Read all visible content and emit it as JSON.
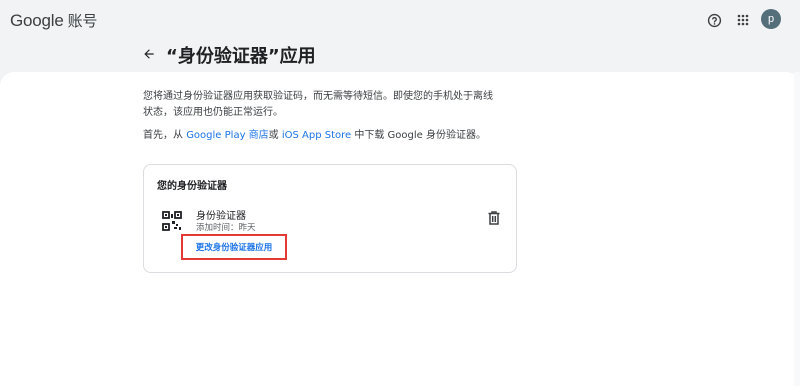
{
  "header": {
    "logo_google": "Google",
    "logo_account": "账号",
    "help_icon": "help-circle-icon",
    "apps_icon": "apps-grid-icon",
    "avatar_initial": "p"
  },
  "page": {
    "title": "“身份验证器”应用",
    "back_icon": "arrow-back-icon"
  },
  "content": {
    "description": "您将通过身份验证器应用获取验证码，而无需等待短信。即使您的手机处于离线状态，该应用也仍能正常运行。",
    "download_prefix": "首先，从 ",
    "google_play_link": "Google Play 商店",
    "download_or": "或 ",
    "app_store_link": "iOS App Store",
    "download_suffix": " 中下载 Google 身份验证器。"
  },
  "authenticator_card": {
    "title": "您的身份验证器",
    "item_icon": "qr-code-icon",
    "item_name": "身份验证器",
    "item_added": "添加时间：昨天",
    "delete_icon": "trash-icon",
    "change_link": "更改身份验证器应用"
  },
  "colors": {
    "background": "#f1f3f4",
    "panel": "#ffffff",
    "link": "#1a73e8",
    "highlight_border": "#e53935",
    "avatar": "#546e7a"
  }
}
